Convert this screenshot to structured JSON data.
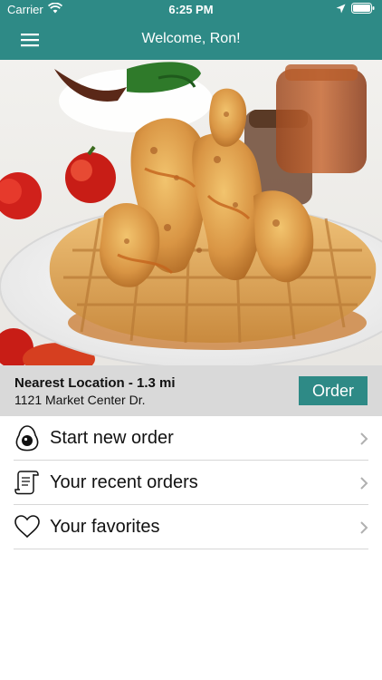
{
  "status_bar": {
    "carrier": "Carrier",
    "time": "6:25 PM",
    "icons": [
      "wifi-icon",
      "location-arrow-icon",
      "battery-icon"
    ]
  },
  "nav": {
    "title": "Welcome, Ron!",
    "menu_icon": "hamburger-menu-icon"
  },
  "hero": {
    "image": "chicken-and-waffles-photo"
  },
  "location": {
    "name": "Nearest Location - 1.3 mi",
    "address": "1121 Market Center Dr.",
    "order_button": "Order"
  },
  "menu": {
    "items": [
      {
        "label": "Start new order",
        "icon": "avocado-icon"
      },
      {
        "label": "Your recent orders",
        "icon": "receipt-icon"
      },
      {
        "label": "Your favorites",
        "icon": "heart-icon"
      }
    ]
  },
  "colors": {
    "brand": "#2e8a86",
    "location_bar_bg": "#d9d9d9",
    "divider": "#d7d7d7"
  }
}
